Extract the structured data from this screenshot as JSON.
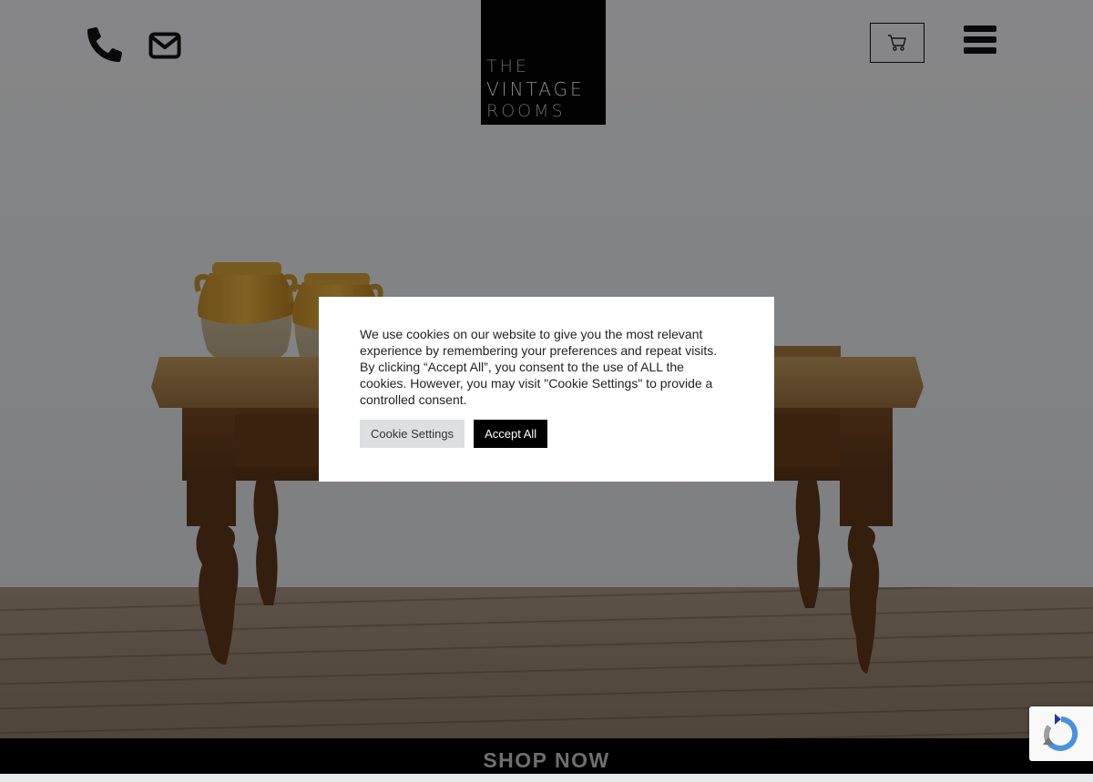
{
  "header": {
    "phone_icon": "phone-icon",
    "email_icon": "envelope-icon",
    "logo": {
      "line1": "THE",
      "line2": "VINTAGE",
      "line3": "ROOMS"
    },
    "cart_icon": "cart-icon",
    "menu_icon": "hamburger-menu-icon"
  },
  "hero": {
    "image": "antique wooden table with two yellow glazed pots"
  },
  "cookie_notice": {
    "text": "We use cookies on our website to give you the most relevant experience by remembering your preferences and repeat visits. By clicking “Accept All”, you consent to the use of ALL the cookies. However, you may visit \"Cookie Settings\" to provide a controlled consent.",
    "settings_label": "Cookie Settings",
    "accept_label": "Accept All"
  },
  "shop_bar": {
    "label": "SHOP NOW"
  },
  "recaptcha": {
    "icon": "recaptcha-icon"
  },
  "colors": {
    "overlay": "#000000",
    "accept_button": "#000000",
    "settings_button": "#dedfe0",
    "shop_bar": "#000000"
  }
}
